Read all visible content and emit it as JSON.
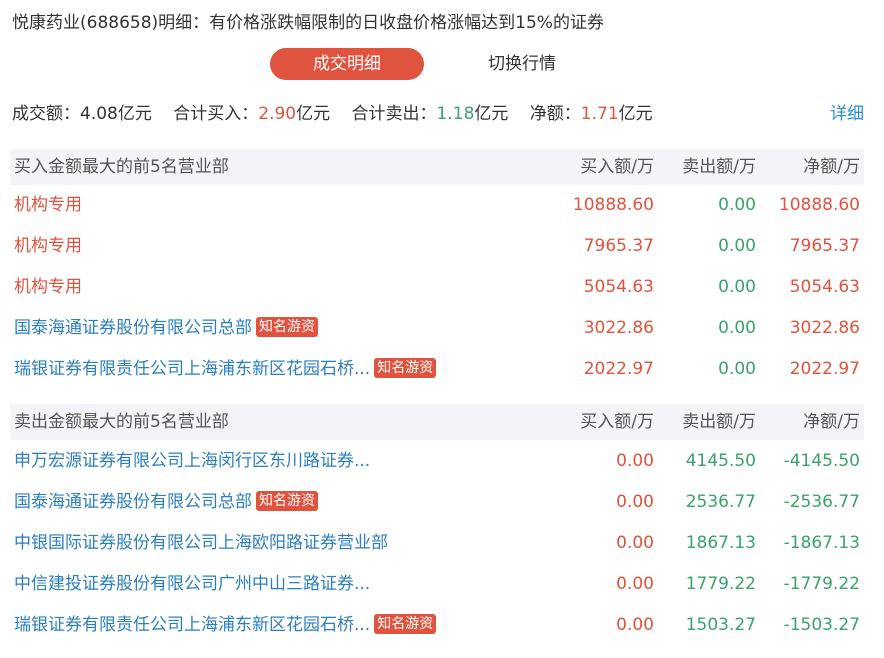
{
  "title": "悦康药业(688658)明细：有价格涨跌幅限制的日收盘价格涨幅达到15%的证券",
  "tabs": {
    "active": "成交明细",
    "inactive": "切换行情"
  },
  "summary": {
    "turnover_label": "成交额：",
    "turnover_value": "4.08",
    "turnover_unit": "亿元",
    "buy_label": "合计买入：",
    "buy_value": "2.90",
    "buy_unit": "亿元",
    "sell_label": "合计卖出：",
    "sell_value": "1.18",
    "sell_unit": "亿元",
    "net_label": "净额：",
    "net_value": "1.71",
    "net_unit": "亿元",
    "detail_link": "详细"
  },
  "colors": {
    "red": "#e0533e",
    "green": "#3aa36b",
    "link": "#2b7fc1",
    "header_bg": "#f2f4f7"
  },
  "buy_section": {
    "header": "买入金额最大的前5名营业部",
    "col_buy": "买入额/万",
    "col_sell": "卖出额/万",
    "col_net": "净额/万",
    "rows": [
      {
        "name": "机构专用",
        "tag": "",
        "buy": "10888.60",
        "sell": "0.00",
        "net": "10888.60"
      },
      {
        "name": "机构专用",
        "tag": "",
        "buy": "7965.37",
        "sell": "0.00",
        "net": "7965.37"
      },
      {
        "name": "机构专用",
        "tag": "",
        "buy": "5054.63",
        "sell": "0.00",
        "net": "5054.63"
      },
      {
        "name": "国泰海通证券股份有限公司总部",
        "tag": "知名游资",
        "buy": "3022.86",
        "sell": "0.00",
        "net": "3022.86"
      },
      {
        "name": "瑞银证券有限责任公司上海浦东新区花园石桥...",
        "tag": "知名游资",
        "buy": "2022.97",
        "sell": "0.00",
        "net": "2022.97"
      }
    ]
  },
  "sell_section": {
    "header": "卖出金额最大的前5名营业部",
    "col_buy": "买入额/万",
    "col_sell": "卖出额/万",
    "col_net": "净额/万",
    "rows": [
      {
        "name": "申万宏源证券有限公司上海闵行区东川路证券...",
        "tag": "",
        "buy": "0.00",
        "sell": "4145.50",
        "net": "-4145.50"
      },
      {
        "name": "国泰海通证券股份有限公司总部",
        "tag": "知名游资",
        "buy": "0.00",
        "sell": "2536.77",
        "net": "-2536.77"
      },
      {
        "name": "中银国际证券股份有限公司上海欧阳路证券营业部",
        "tag": "",
        "buy": "0.00",
        "sell": "1867.13",
        "net": "-1867.13"
      },
      {
        "name": "中信建投证券股份有限公司广州中山三路证券...",
        "tag": "",
        "buy": "0.00",
        "sell": "1779.22",
        "net": "-1779.22"
      },
      {
        "name": "瑞银证券有限责任公司上海浦东新区花园石桥...",
        "tag": "知名游资",
        "buy": "0.00",
        "sell": "1503.27",
        "net": "-1503.27"
      }
    ]
  }
}
